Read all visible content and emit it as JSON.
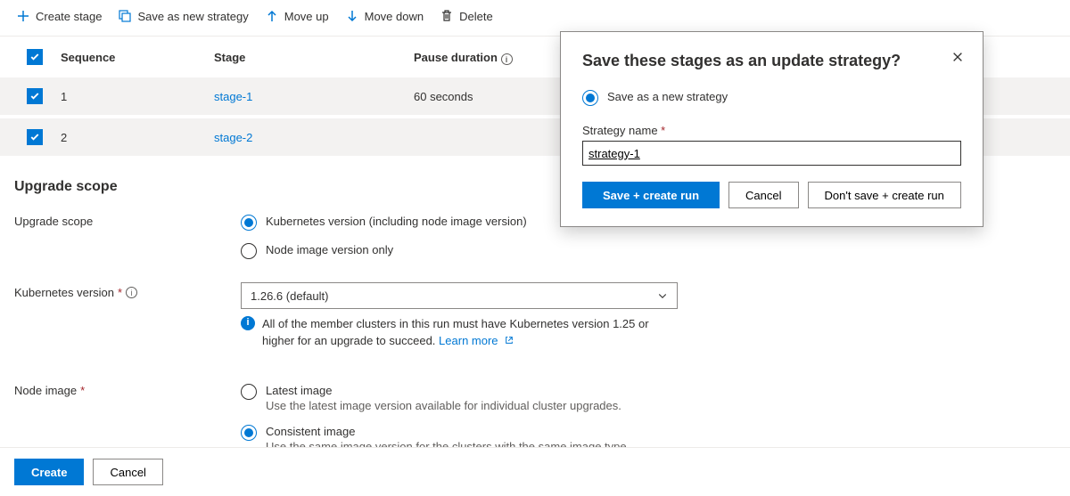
{
  "toolbar": {
    "create_stage": "Create stage",
    "save_as_new_strategy": "Save as new strategy",
    "move_up": "Move up",
    "move_down": "Move down",
    "delete": "Delete"
  },
  "table": {
    "headers": {
      "sequence": "Sequence",
      "stage": "Stage",
      "pause": "Pause duration"
    },
    "rows": [
      {
        "seq": "1",
        "stage": "stage-1",
        "pause": "60 seconds"
      },
      {
        "seq": "2",
        "stage": "stage-2",
        "pause": ""
      }
    ]
  },
  "section_title": "Upgrade scope",
  "upgrade_scope": {
    "label": "Upgrade scope",
    "opt_k8s": "Kubernetes version (including node image version)",
    "opt_node": "Node image version only"
  },
  "k8s_version": {
    "label": "Kubernetes version",
    "value": "1.26.6 (default)",
    "helper": "All of the member clusters in this run must have Kubernetes version 1.25 or higher for an upgrade to succeed.",
    "learn_more": "Learn more"
  },
  "node_image": {
    "label": "Node image",
    "opt_latest": "Latest image",
    "opt_latest_sub": "Use the latest image version available for individual cluster upgrades.",
    "opt_consistent": "Consistent image",
    "opt_consistent_sub": "Use the same image version for the clusters with the same image type."
  },
  "footer": {
    "create": "Create",
    "cancel": "Cancel"
  },
  "dialog": {
    "title": "Save these stages as an update strategy?",
    "radio_save_new": "Save as a new strategy",
    "name_label": "Strategy name",
    "name_value": "strategy-1",
    "save_create": "Save + create run",
    "cancel": "Cancel",
    "dont_save": "Don't save + create run"
  }
}
